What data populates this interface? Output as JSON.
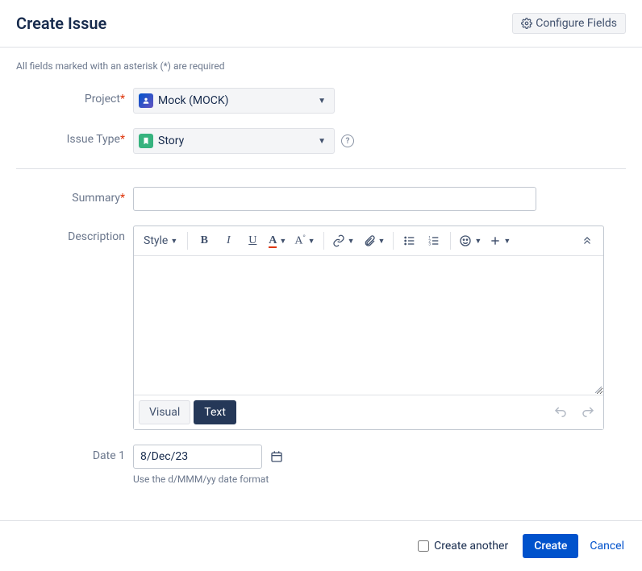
{
  "header": {
    "title": "Create Issue",
    "configure_fields_label": "Configure Fields"
  },
  "required_note": "All fields marked with an asterisk (*) are required",
  "fields": {
    "project": {
      "label": "Project",
      "value": "Mock (MOCK)"
    },
    "issue_type": {
      "label": "Issue Type",
      "value": "Story"
    },
    "summary": {
      "label": "Summary",
      "value": ""
    },
    "description": {
      "label": "Description"
    },
    "date1": {
      "label": "Date 1",
      "value": "8/Dec/23",
      "hint": "Use the d/MMM/yy date format"
    }
  },
  "rte": {
    "style_label": "Style",
    "visual_tab": "Visual",
    "text_tab": "Text"
  },
  "footer": {
    "create_another_label": "Create another",
    "create_label": "Create",
    "cancel_label": "Cancel"
  }
}
